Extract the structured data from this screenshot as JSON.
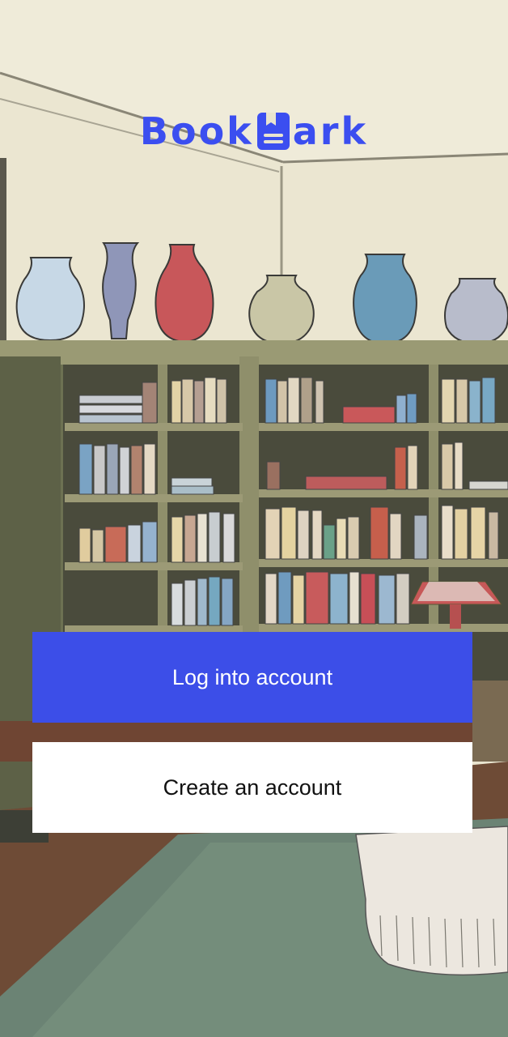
{
  "app": {
    "logo_text_left": "Book",
    "logo_text_right": "ark",
    "logo_icon": "bookmark-icon",
    "brand_color": "#3b4ef0"
  },
  "actions": {
    "login_label": "Log into account",
    "create_label": "Create an account",
    "login_color": "#3c4ee8",
    "create_color": "#ffffff"
  },
  "background": {
    "illustration": "library-watercolor-illustration"
  }
}
